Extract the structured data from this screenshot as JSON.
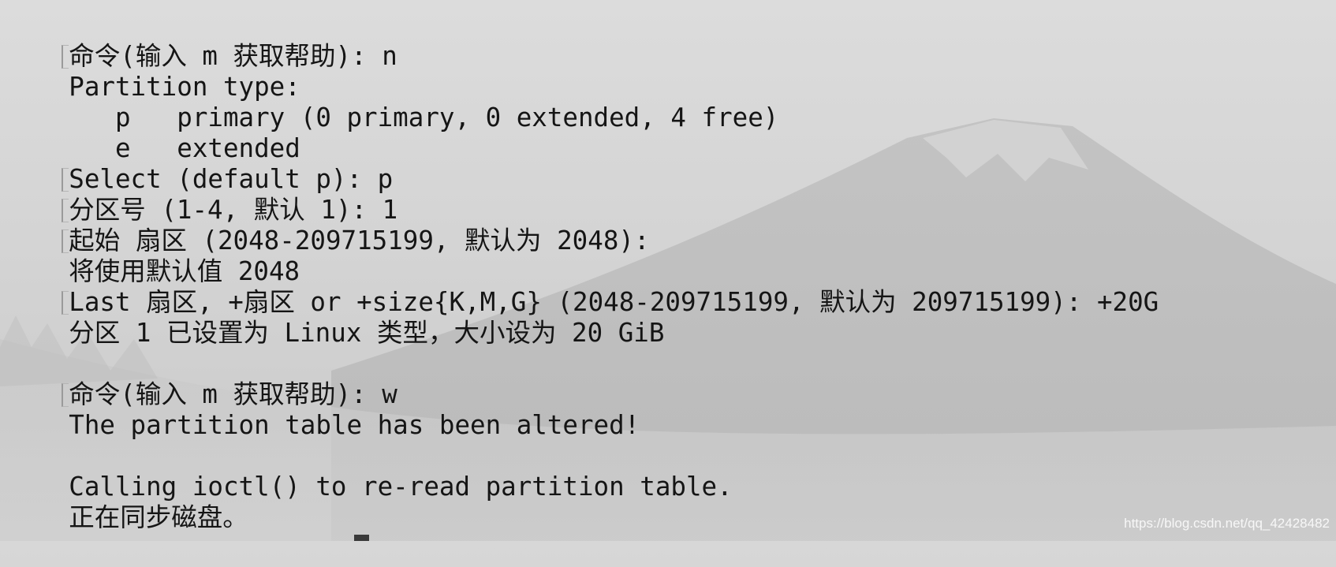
{
  "terminal": {
    "lines": [
      {
        "prompt": true,
        "text": "命令(输入 m 获取帮助): n"
      },
      {
        "prompt": false,
        "text": "Partition type:"
      },
      {
        "prompt": false,
        "text": "   p   primary (0 primary, 0 extended, 4 free)"
      },
      {
        "prompt": false,
        "text": "   e   extended"
      },
      {
        "prompt": true,
        "text": "Select (default p): p"
      },
      {
        "prompt": true,
        "text": "分区号 (1-4, 默认 1): 1"
      },
      {
        "prompt": true,
        "text": "起始 扇区 (2048-209715199, 默认为 2048):"
      },
      {
        "prompt": false,
        "text": "将使用默认值 2048"
      },
      {
        "prompt": true,
        "text": "Last 扇区, +扇区 or +size{K,M,G} (2048-209715199, 默认为 209715199): +20G"
      },
      {
        "prompt": false,
        "text": "分区 1 已设置为 Linux 类型，大小设为 20 GiB"
      },
      {
        "prompt": false,
        "text": ""
      },
      {
        "prompt": true,
        "text": "命令(输入 m 获取帮助): w"
      },
      {
        "prompt": false,
        "text": "The partition table has been altered!"
      },
      {
        "prompt": false,
        "text": ""
      },
      {
        "prompt": false,
        "text": "Calling ioctl() to re-read partition table."
      },
      {
        "prompt": false,
        "text": "正在同步磁盘。"
      }
    ]
  },
  "watermark": "https://blog.csdn.net/qq_42428482",
  "colors": {
    "text": "#151515",
    "background": "#d4d4d4"
  }
}
